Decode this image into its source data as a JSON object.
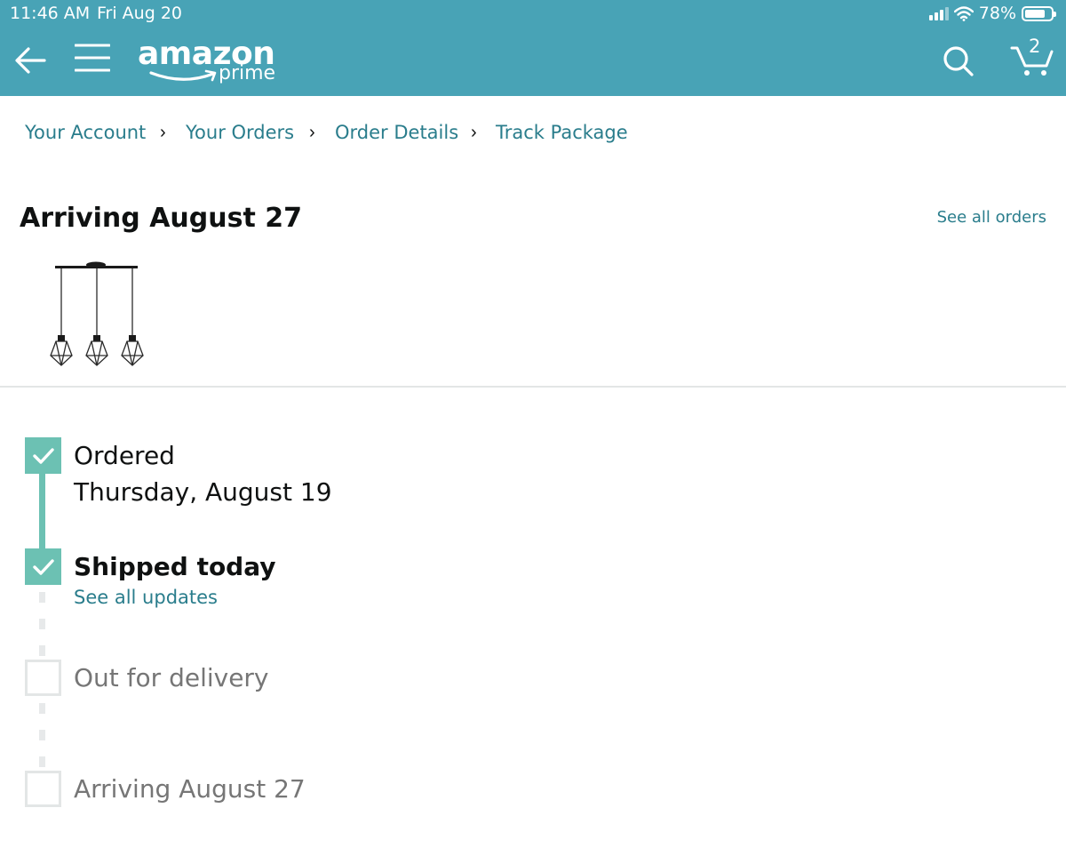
{
  "status_bar": {
    "time": "11:46 AM",
    "date": "Fri Aug 20",
    "battery": "78%",
    "battery_level": 0.78
  },
  "header": {
    "logo_main": "amazon",
    "logo_sub": "prime",
    "cart_count": "2"
  },
  "icons": [
    "back-arrow-icon",
    "menu-icon",
    "search-icon",
    "cart-icon",
    "checkmark-icon",
    "wifi-icon",
    "signal-icon",
    "battery-icon"
  ],
  "colors": {
    "header": "#48a3b6",
    "link": "#2a7d8c",
    "progress": "#6cc1b3",
    "pending": "#e3e6e6"
  },
  "breadcrumb": {
    "items": [
      "Your Account",
      "Your Orders",
      "Order Details",
      "Track Package"
    ],
    "separator": "›"
  },
  "title": "Arriving August 27",
  "see_all_orders": "See all orders",
  "timeline": {
    "steps": [
      {
        "label": "Ordered",
        "detail": "Thursday, August 19",
        "state": "done"
      },
      {
        "label": "Shipped today",
        "link": "See all updates",
        "state": "current"
      },
      {
        "label": "Out for delivery",
        "state": "pending"
      },
      {
        "label": "Arriving August 27",
        "state": "pending"
      }
    ]
  }
}
